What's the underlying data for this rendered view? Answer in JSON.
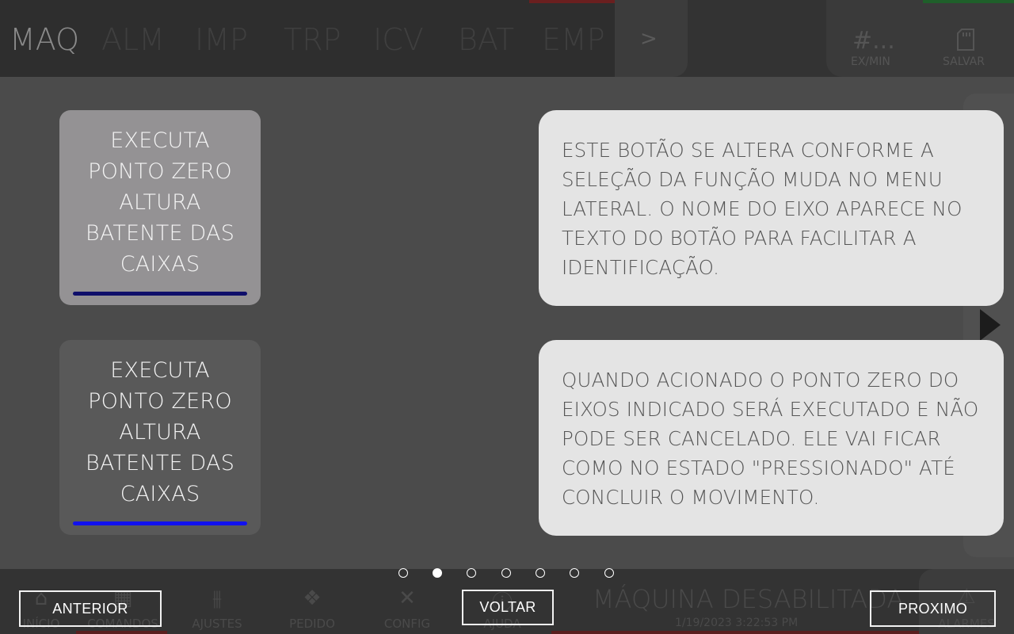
{
  "header": {
    "tabs": [
      {
        "label": "MAQ",
        "active": true
      },
      {
        "label": "ALM",
        "active": false
      },
      {
        "label": "IMP",
        "active": false
      },
      {
        "label": "TRP",
        "active": false
      },
      {
        "label": "ICV",
        "active": false
      },
      {
        "label": "BAT",
        "active": false
      },
      {
        "label": "EMP",
        "active": false
      }
    ],
    "more_label": ">",
    "rate_value": "#...",
    "rate_label": "EX/MIN",
    "save_label": "SALVAR"
  },
  "bottom_nav": {
    "items": [
      {
        "label": "INÍCIO",
        "icon": "home-icon"
      },
      {
        "label": "COMANDOS",
        "icon": "grid-icon"
      },
      {
        "label": "AJUSTES",
        "icon": "sliders-icon"
      },
      {
        "label": "PEDIDO",
        "icon": "boxes-icon"
      },
      {
        "label": "CONFIG",
        "icon": "tools-icon"
      },
      {
        "label": "AJUDA",
        "icon": "info-icon"
      }
    ],
    "status_text": "MÁQUINA DESABILITADA",
    "status_time": "1/19/2023 3:22:53 PM",
    "alarm_label": "ALARMES"
  },
  "help": {
    "pressed_button_text": "EXECUTA PONTO ZERO ALTURA BATENTE DAS CAIXAS",
    "normal_button_text": "EXECUTA PONTO ZERO ALTURA BATENTE DAS CAIXAS",
    "note_1": "ESTE BOTÃO SE ALTERA CONFORME A SELEÇÃO DA FUNÇÃO MUDA NO MENU LATERAL. O NOME DO EIXO APARECE NO TEXTO DO BOTÃO PARA FACILITAR A IDENTIFICAÇÃO.",
    "note_2": "QUANDO ACIONADO O PONTO ZERO DO EIXOS INDICADO SERÁ EXECUTADO E NÃO PODE SER CANCELADO. ELE VAI FICAR COMO NO ESTADO \"PRESSIONADO\" ATÉ CONCLUIR O MOVIMENTO."
  },
  "pagination": {
    "total": 7,
    "current": 2
  },
  "footer_buttons": {
    "previous": "ANTERIOR",
    "back": "VOLTAR",
    "next": "PROXIMO"
  },
  "colors": {
    "pressed_button": "#949294",
    "normal_button": "#595959",
    "pressed_indicator": "#0f0f6a",
    "normal_indicator": "#1111ee",
    "note_background": "#e4e4e4"
  }
}
